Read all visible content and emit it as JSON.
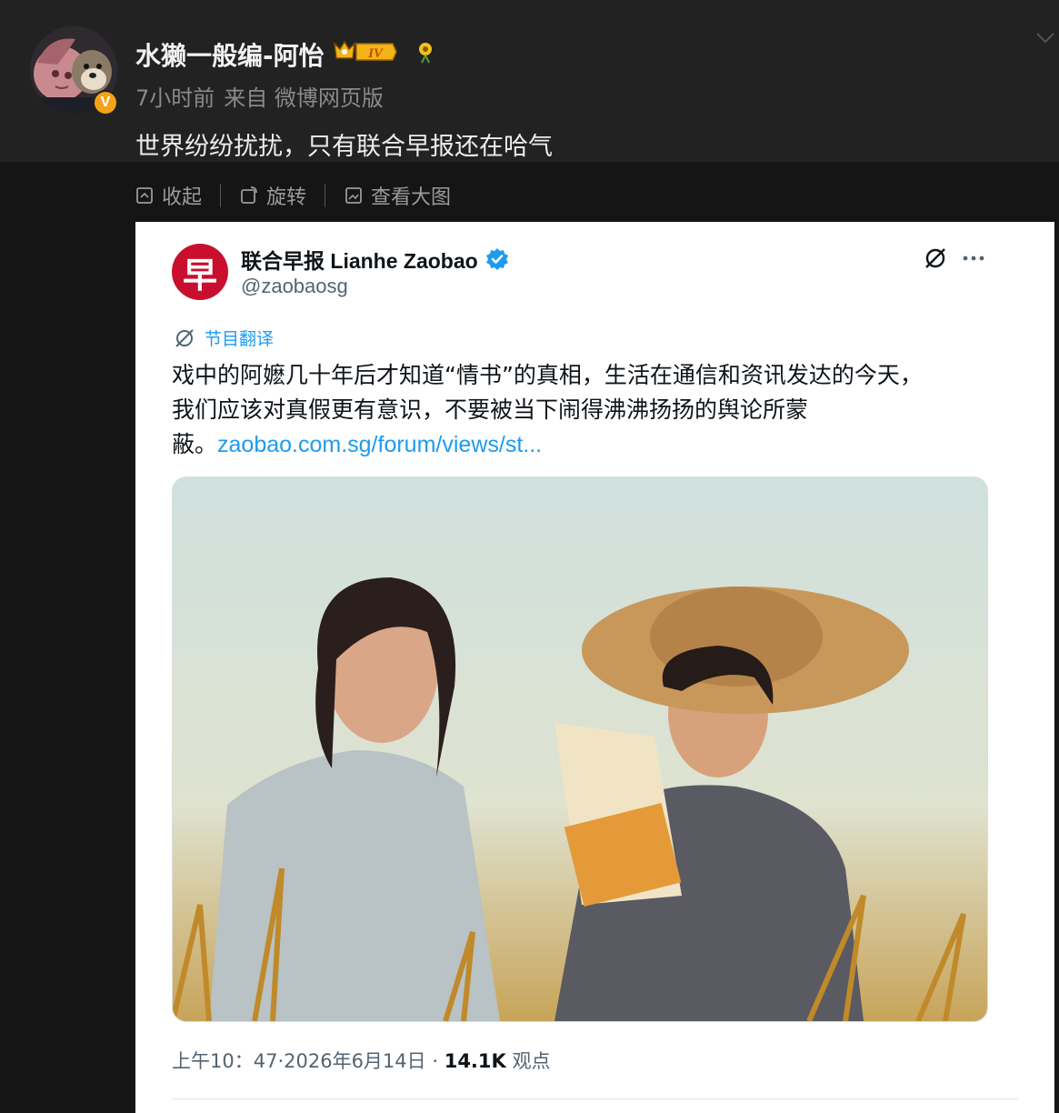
{
  "post": {
    "username": "水獭一般编-阿怡",
    "level": "IV",
    "verified_badge": "V",
    "time": "7小时前",
    "source": "来自 微博网页版",
    "text": "世界纷纷扰扰，只有联合早报还在哈气"
  },
  "image_toolbar": {
    "collapse": "收起",
    "rotate": "旋转",
    "view_large": "查看大图"
  },
  "tweet": {
    "logo_char": "早",
    "account_name": "联合早报 Lianhe Zaobao",
    "handle": "@zaobaosg",
    "translate_label": "节目翻译",
    "text_line1": "戏中的阿嬷几十年后才知道“情书”的真相，生活在通信和资讯发达的今天，",
    "text_line2": "我们应该对真假更有意识，不要被当下闹得沸沸扬扬的舆论所蒙",
    "text_line3": "蔽。",
    "link": "zaobao.com.sg/forum/views/st...",
    "timestamp": "上午10：47",
    "date": "·2026年6月14日 ·",
    "views_count": "14.1K",
    "views_label": "观点"
  },
  "colors": {
    "page_bg": "#151515",
    "header_bg": "#222222",
    "link_blue": "#1d9bf0",
    "zaobao_red": "#c8102e",
    "verified_gold": "#f4a21a"
  }
}
